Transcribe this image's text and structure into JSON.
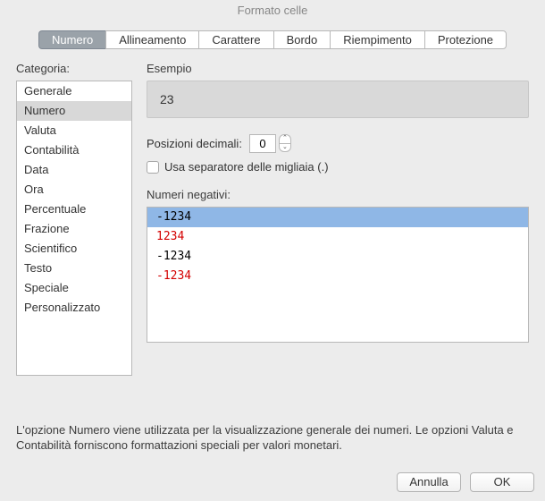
{
  "window": {
    "title": "Formato celle"
  },
  "tabs": [
    {
      "label": "Numero"
    },
    {
      "label": "Allineamento"
    },
    {
      "label": "Carattere"
    },
    {
      "label": "Bordo"
    },
    {
      "label": "Riempimento"
    },
    {
      "label": "Protezione"
    }
  ],
  "active_tab_index": 0,
  "labels": {
    "category": "Categoria:",
    "example": "Esempio",
    "decimals": "Posizioni decimali:",
    "thousands": "Usa separatore delle migliaia (.)",
    "negatives": "Numeri negativi:"
  },
  "example_value": "23",
  "decimals_value": "0",
  "thousands_checked": false,
  "categories": [
    "Generale",
    "Numero",
    "Valuta",
    "Contabilità",
    "Data",
    "Ora",
    "Percentuale",
    "Frazione",
    "Scientifico",
    "Testo",
    "Speciale",
    "Personalizzato"
  ],
  "selected_category_index": 1,
  "negatives": [
    {
      "text": "-1234",
      "red": false
    },
    {
      "text": "1234",
      "red": true
    },
    {
      "text": "-1234",
      "red": false
    },
    {
      "text": "-1234",
      "red": true
    }
  ],
  "selected_negative_index": 0,
  "description": "L'opzione Numero viene utilizzata per la visualizzazione generale dei numeri. Le opzioni Valuta e Contabilità forniscono formattazioni speciali per valori monetari.",
  "buttons": {
    "cancel": "Annulla",
    "ok": "OK"
  }
}
